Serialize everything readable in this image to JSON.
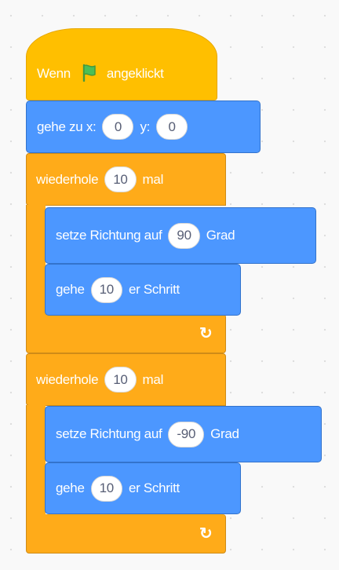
{
  "script": {
    "hat": {
      "prefix": "Wenn",
      "suffix": "angeklickt",
      "icon": "green-flag-icon"
    },
    "goto": {
      "label": "gehe zu x:",
      "x": "0",
      "y_label": "y:",
      "y": "0"
    },
    "loops": [
      {
        "label_prefix": "wiederhole",
        "count": "10",
        "label_suffix": "mal",
        "direction": {
          "label": "setze Richtung auf",
          "value": "90",
          "unit": "Grad"
        },
        "move": {
          "label": "gehe",
          "value": "10",
          "unit": "er Schritt"
        },
        "repeat_icon": "repeat-arrow-icon"
      },
      {
        "label_prefix": "wiederhole",
        "count": "10",
        "label_suffix": "mal",
        "direction": {
          "label": "setze Richtung auf",
          "value": "-90",
          "unit": "Grad"
        },
        "move": {
          "label": "gehe",
          "value": "10",
          "unit": "er Schritt"
        },
        "repeat_icon": "repeat-arrow-icon"
      }
    ]
  },
  "colors": {
    "events": "#ffbf00",
    "motion": "#4c97ff",
    "control": "#ffab19",
    "flag": "#4cbf56"
  }
}
